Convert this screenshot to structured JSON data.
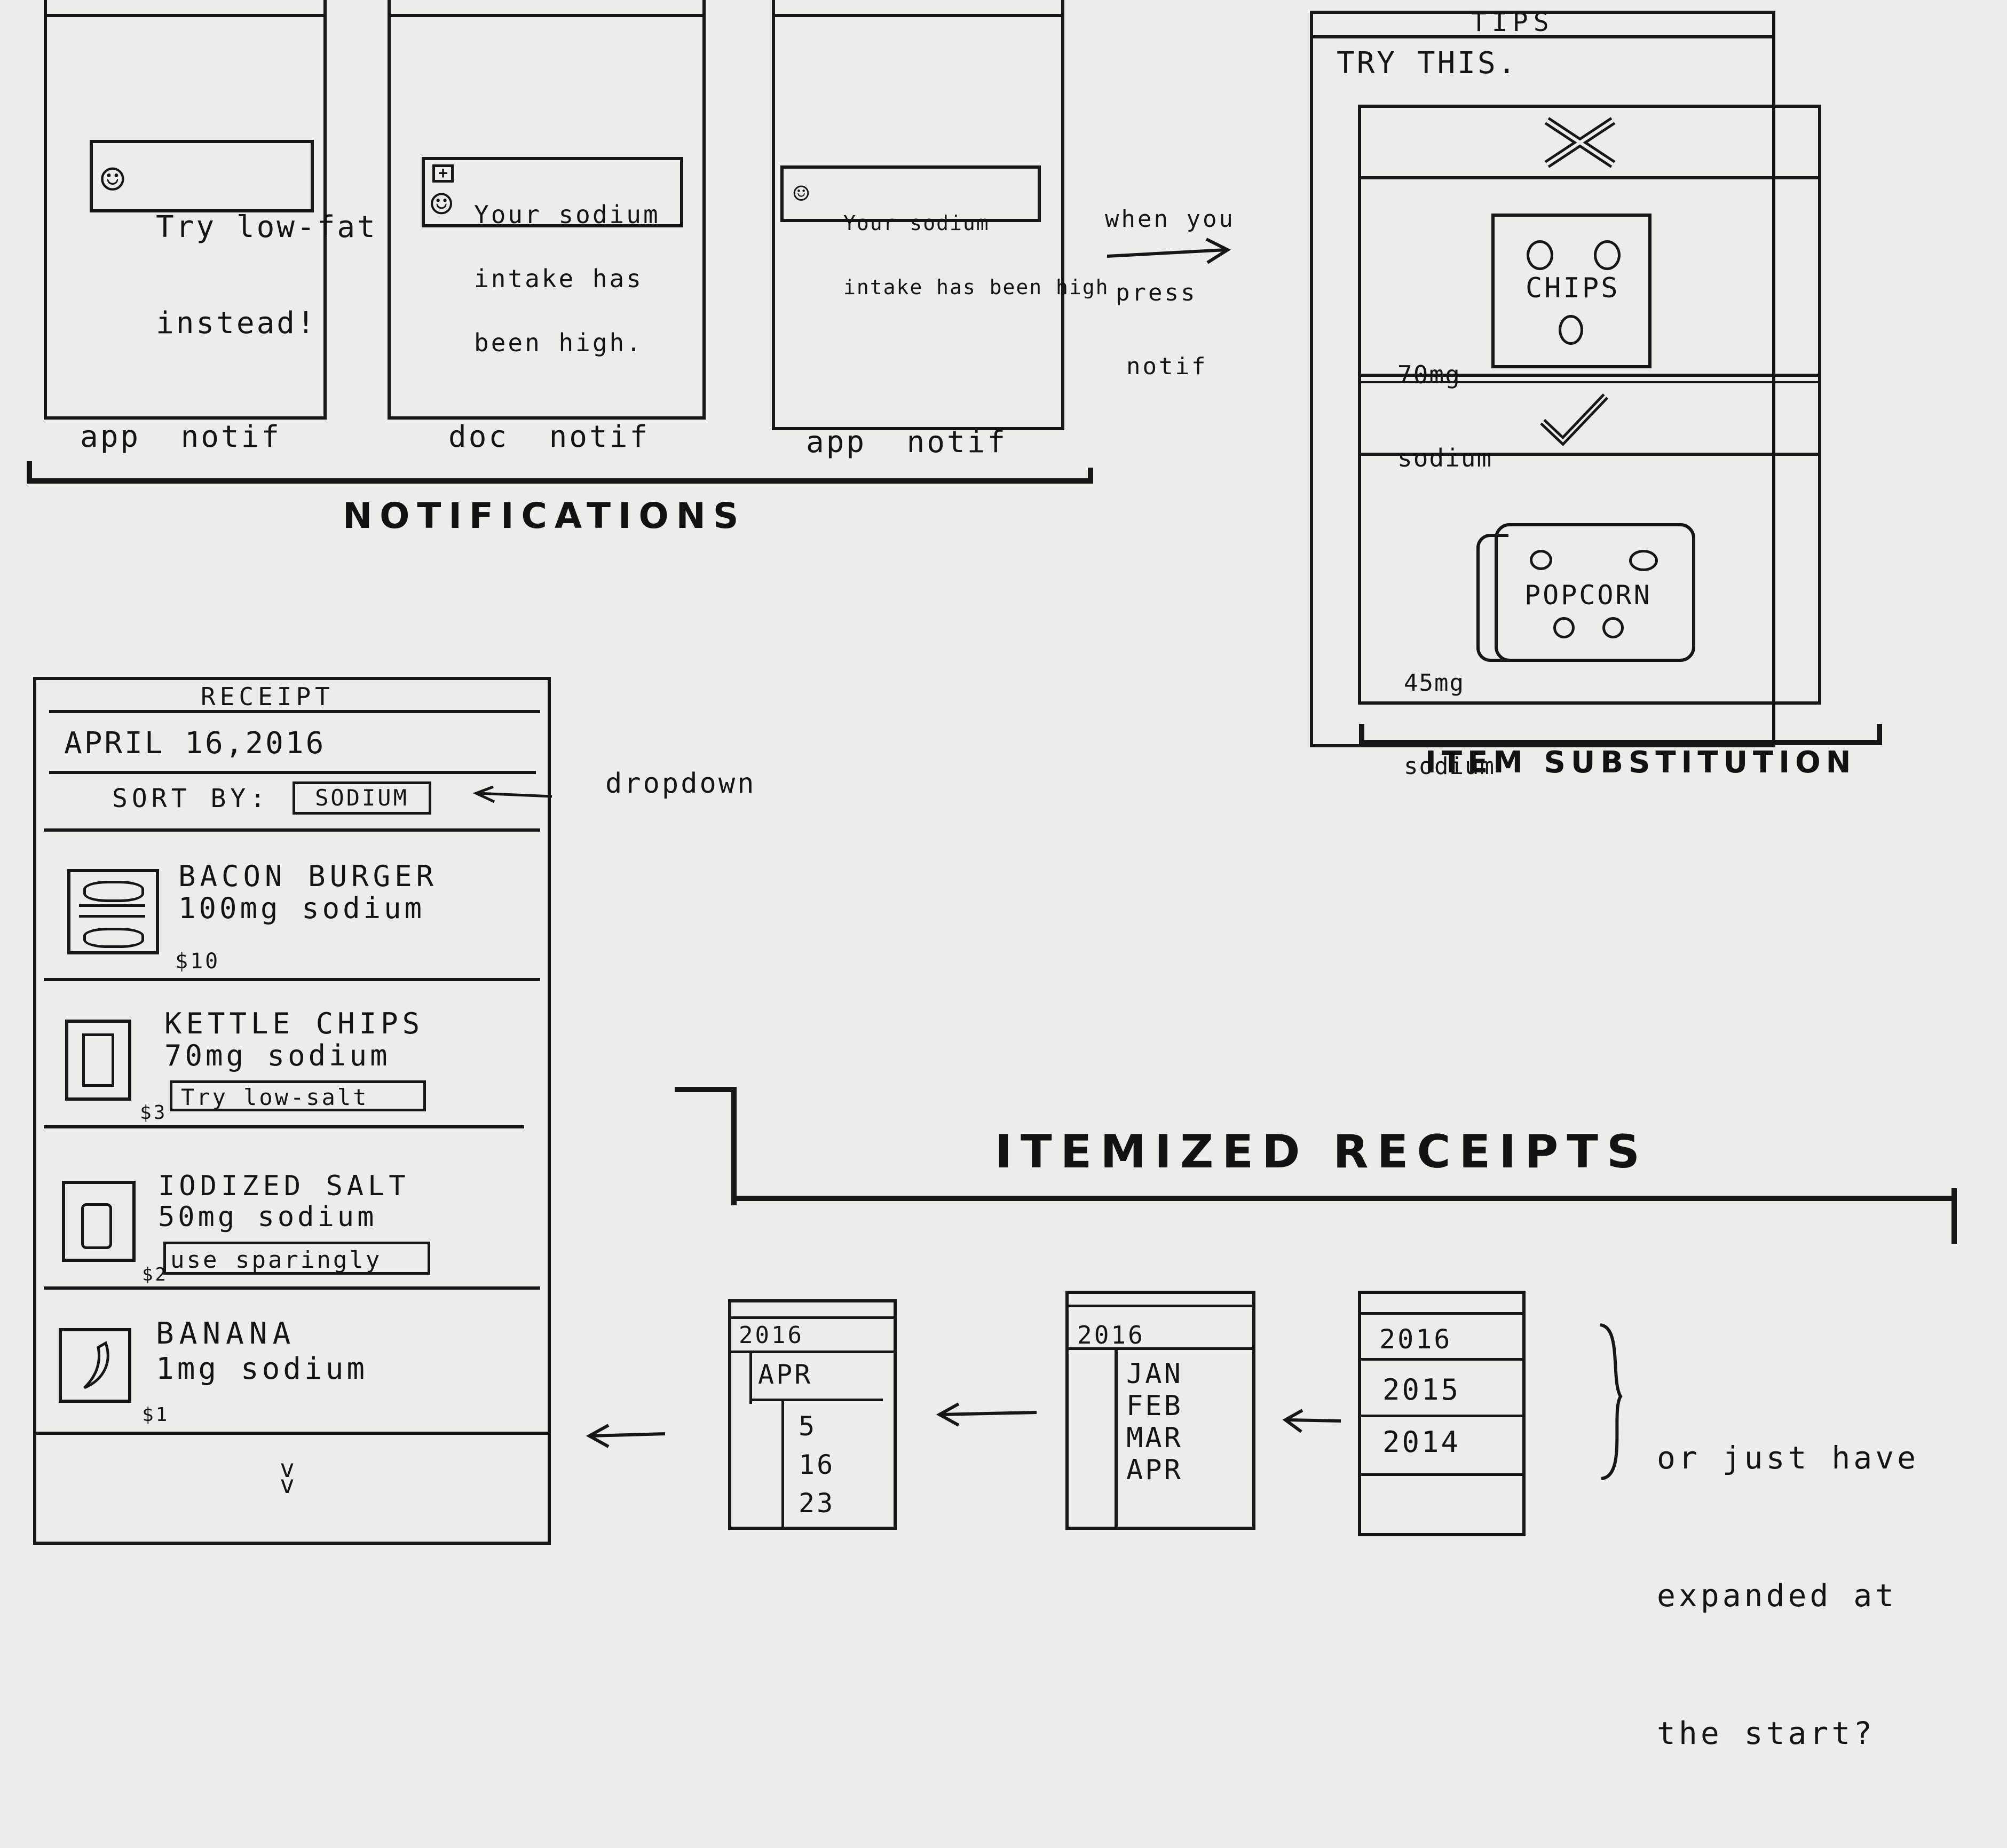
{
  "notifications": {
    "section_label": "NOTIFICATIONS",
    "screens": [
      {
        "message_lines": [
          "Try low-fat",
          "instead!"
        ],
        "caption": "app  notif"
      },
      {
        "message_lines": [
          "Your sodium",
          "intake has",
          "been high."
        ],
        "caption": "doc  notif"
      },
      {
        "message_lines": [
          "Your sodium",
          "intake has been high"
        ],
        "caption": "app  notif"
      }
    ],
    "arrow_note": [
      "when you",
      "press",
      "notif"
    ]
  },
  "tips": {
    "title": "TIPS",
    "subtitle": "TRY THIS.",
    "bad_item": {
      "label": "CHIPS",
      "sodium_lines": [
        "70mg",
        "sodium"
      ]
    },
    "good_item": {
      "label": "POPCORN",
      "sodium_lines": [
        "45mg",
        "sodium"
      ]
    },
    "section_label": "ITEM SUBSTITUTION"
  },
  "receipt": {
    "title": "RECEIPT",
    "date": "APRIL 16,2016",
    "sort_label": "SORT BY:",
    "sort_value": "SODIUM",
    "dropdown_note": "dropdown",
    "items": [
      {
        "name": "BACON BURGER",
        "sodium": "100mg sodium",
        "price": "$10",
        "tip": ""
      },
      {
        "name": "KETTLE CHIPS",
        "sodium": "70mg sodium",
        "price": "$3",
        "tip": "Try low-salt"
      },
      {
        "name": "IODIZED SALT",
        "sodium": "50mg sodium",
        "price": "$2",
        "tip": "use sparingly"
      },
      {
        "name": "BANANA",
        "sodium": "1mg sodium",
        "price": "$1",
        "tip": ""
      }
    ],
    "more_glyph": "v"
  },
  "itemized": {
    "section_label": "ITEMIZED RECEIPTS",
    "year_list": [
      "2016",
      "2015",
      "2014"
    ],
    "month_view": {
      "year": "2016",
      "months": [
        "JAN",
        "FEB",
        "MAR",
        "APR"
      ]
    },
    "day_view": {
      "year": "2016",
      "month": "APR",
      "days": [
        "5",
        "16",
        "23"
      ]
    },
    "side_note": [
      "or just have",
      "expanded at",
      "the start?"
    ]
  }
}
